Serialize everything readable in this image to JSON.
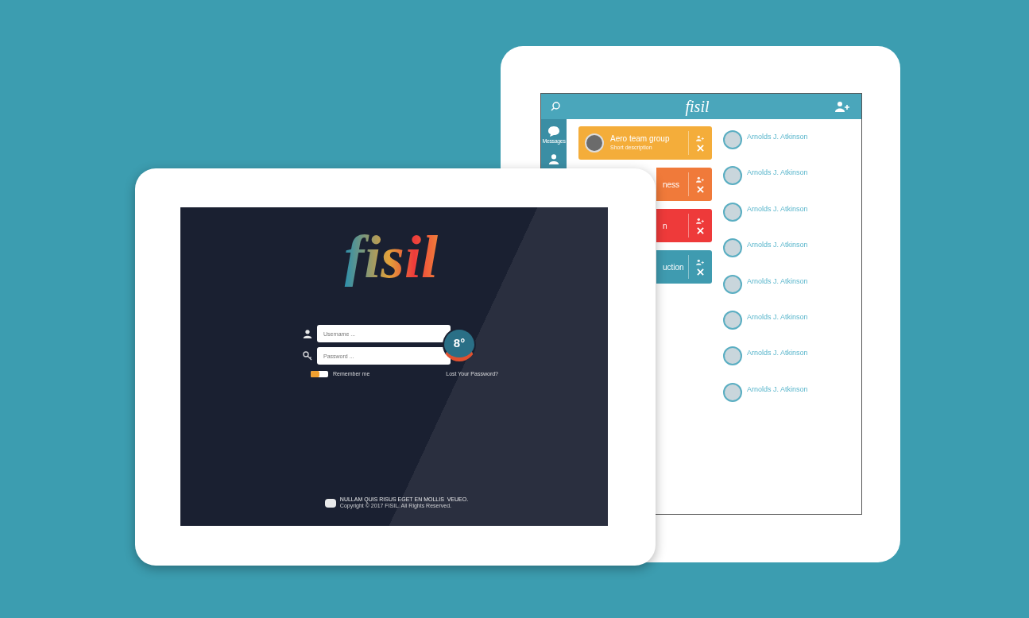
{
  "contacts_screen": {
    "header": {
      "logo": "fisil"
    },
    "sidebar": [
      {
        "kind": "messages",
        "label": "Messages"
      },
      {
        "kind": "profile"
      }
    ],
    "groups": [
      {
        "name": "Aero team group",
        "description": "Short description",
        "color": "#f4ad3a"
      },
      {
        "name": "ness",
        "color": "#f07a3a"
      },
      {
        "name": "n",
        "color": "#ee3a3a"
      },
      {
        "name": "uction",
        "color": "#3f9bb0"
      }
    ],
    "contacts": [
      {
        "name": "Arnolds J. Atkinson"
      },
      {
        "name": "Arnolds J. Atkinson"
      },
      {
        "name": "Arnolds J. Atkinson"
      },
      {
        "name": "Arnolds J. Atkinson"
      },
      {
        "name": "Arnolds J. Atkinson"
      },
      {
        "name": "Arnolds J. Atkinson"
      },
      {
        "name": "Arnolds J. Atkinson"
      },
      {
        "name": "Arnolds J. Atkinson"
      }
    ]
  },
  "login_screen": {
    "logo": "fisil",
    "username": {
      "placeholder": "Username ..."
    },
    "password": {
      "placeholder": "Password ..."
    },
    "go_badge": "8°",
    "remember": {
      "label": "Remember me",
      "on": true
    },
    "lost_password": "Lost Your Password?",
    "footer": {
      "tagline": "NULLAM QUIS RISUS EGET EN MOLLIS  VEUEO.",
      "copyright": "Copyright © 2017 FISIL. All Rights Reserved."
    }
  }
}
